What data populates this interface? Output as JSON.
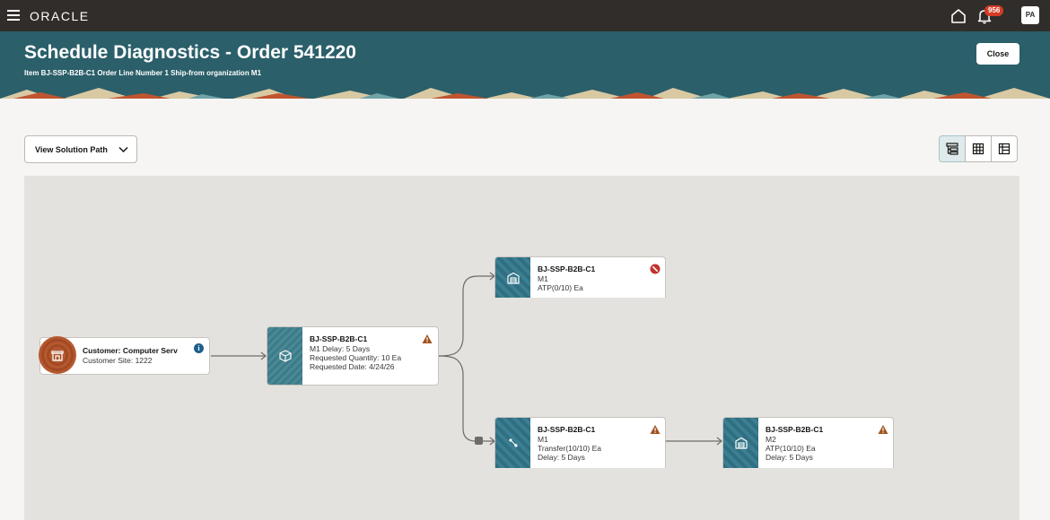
{
  "topbar": {
    "brand": "ORACLE",
    "notifications_count": "956",
    "avatar_initials": "PA"
  },
  "header": {
    "title": "Schedule Diagnostics - Order 541220",
    "subtitle": "Item BJ-SSP-B2B-C1 Order Line Number 1 Ship-from organization M1",
    "close_label": "Close"
  },
  "toolbar": {
    "view_select_value": "View Solution Path",
    "views": [
      "tree-view-icon",
      "grid-view-icon",
      "table-view-icon"
    ]
  },
  "diagram": {
    "customer": {
      "title": "Customer: Computer Serv",
      "line1": "Customer Site: 1222",
      "status": "info"
    },
    "order_node": {
      "title": "BJ-SSP-B2B-C1",
      "lines": [
        "M1 Delay: 5 Days",
        "Requested Quantity: 10 Ea",
        "Requested Date: 4/24/26"
      ],
      "status": "warning"
    },
    "top_node": {
      "title": "BJ-SSP-B2B-C1",
      "lines": [
        "M1",
        "ATP(0/10) Ea"
      ],
      "status": "error"
    },
    "transfer_node": {
      "title": "BJ-SSP-B2B-C1",
      "lines": [
        "M1",
        "Transfer(10/10) Ea",
        "Delay: 5 Days"
      ],
      "status": "warning"
    },
    "m2_node": {
      "title": "BJ-SSP-B2B-C1",
      "lines": [
        "M2",
        "ATP(10/10) Ea",
        "Delay: 5 Days"
      ],
      "status": "warning"
    }
  },
  "colors": {
    "topbar": "#312d2a",
    "header": "#2b5f6a",
    "warning": "#a1521e",
    "error": "#c2332b",
    "info": "#1e5e8c"
  }
}
